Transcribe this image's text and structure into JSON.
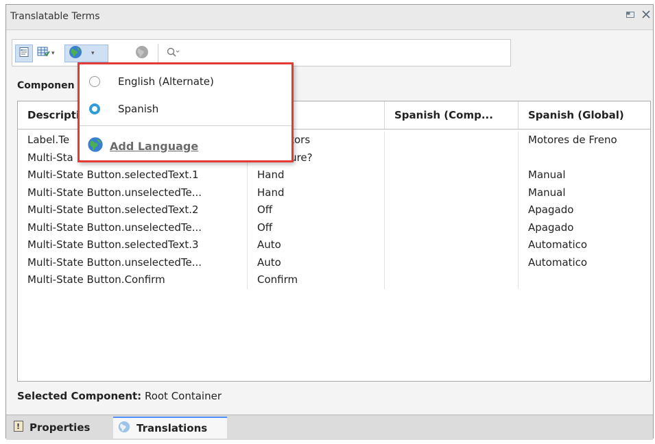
{
  "window": {
    "title": "Translatable Terms"
  },
  "toolbar": {
    "buttons": [
      {
        "icon": "term-list-icon"
      },
      {
        "icon": "table-view-icon"
      },
      {
        "icon": "globe-icon"
      },
      {
        "icon": "globe-disabled-icon"
      }
    ],
    "search": {
      "value": "",
      "placeholder": ""
    }
  },
  "components_label": "Componen",
  "table": {
    "headers": [
      "Descripti",
      "",
      "Spanish (Comp...",
      "Spanish (Global)"
    ],
    "rows": [
      [
        "Label.Te",
        "Motors",
        "",
        "Motores de Freno"
      ],
      [
        "Multi-Sta",
        "u sure?",
        "",
        ""
      ],
      [
        "Multi-State Button.selectedText.1",
        "Hand",
        "",
        "Manual"
      ],
      [
        "Multi-State Button.unselectedTe...",
        "Hand",
        "",
        "Manual"
      ],
      [
        "Multi-State Button.selectedText.2",
        "Off",
        "",
        "Apagado"
      ],
      [
        "Multi-State Button.unselectedTe...",
        "Off",
        "",
        "Apagado"
      ],
      [
        "Multi-State Button.selectedText.3",
        "Auto",
        "",
        "Automatico"
      ],
      [
        "Multi-State Button.unselectedTe...",
        "Auto",
        "",
        "Automatico"
      ],
      [
        "Multi-State Button.Confirm",
        "Confirm",
        "",
        ""
      ]
    ]
  },
  "selected_component": {
    "label": "Selected Component:",
    "value": " Root Container"
  },
  "bottom_tabs": [
    {
      "label": "Properties",
      "icon": "properties-icon",
      "active": false
    },
    {
      "label": "Translations",
      "icon": "globe-icon",
      "active": true
    }
  ],
  "language_menu": {
    "items": [
      {
        "label": "English (Alternate)",
        "selected": false
      },
      {
        "label": "Spanish",
        "selected": true
      }
    ],
    "add_label": "Add Language"
  },
  "colors": {
    "accent": "#2f9bdb",
    "highlight_border": "#e53935"
  }
}
